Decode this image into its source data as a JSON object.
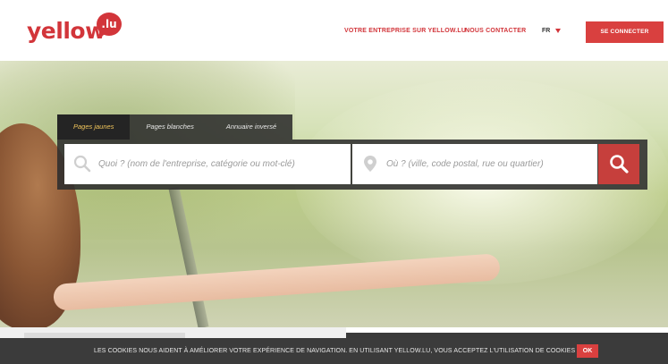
{
  "brand": {
    "logo_text": "yellow",
    "logo_badge": ".lu",
    "accent_color": "#d2353a"
  },
  "header": {
    "nav": {
      "business_link": "VOTRE ENTREPRISE SUR YELLOW.LU",
      "contact_link": "NOUS CONTACTER"
    },
    "language": {
      "selected": "FR",
      "caret_icon": "caret-down-icon"
    },
    "login_button": "SE CONNECTER"
  },
  "search": {
    "tabs": [
      {
        "label": "Pages jaunes",
        "active": true
      },
      {
        "label": "Pages blanches",
        "active": false
      },
      {
        "label": "Annuaire inversé",
        "active": false
      }
    ],
    "what": {
      "placeholder": "Quoi ? (nom de l'entreprise, catégorie ou mot-clé)",
      "icon": "search-icon"
    },
    "where": {
      "placeholder": "Où ? (ville, code postal, rue ou quartier)",
      "icon": "location-pin-icon"
    },
    "submit_icon": "search-icon"
  },
  "cookie_banner": {
    "text": "LES COOKIES NOUS AIDENT À AMÉLIORER VOTRE EXPÉRIENCE DE NAVIGATION. EN UTILISANT YELLOW.LU, VOUS ACCEPTEZ L'UTILISATION DE COOKIES",
    "ok_button": "OK"
  }
}
